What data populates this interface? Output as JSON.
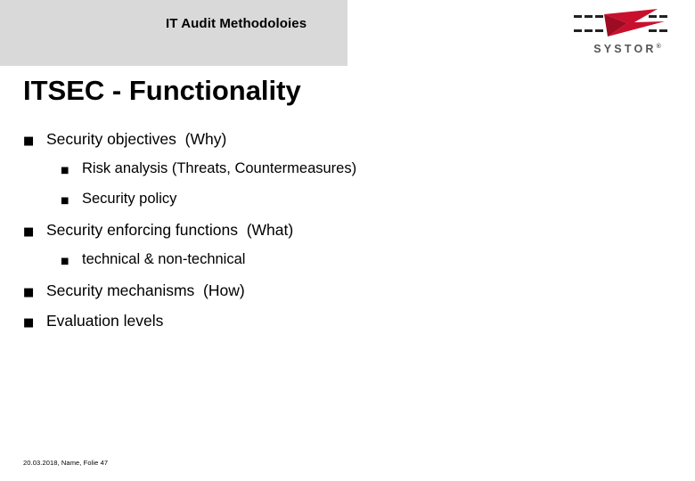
{
  "header": {
    "title": "IT Audit Methodoloies"
  },
  "logo": {
    "wordmark": "SYSTOR",
    "registered": "®",
    "colors": {
      "band": "#d9d9d9",
      "arrow_red": "#c8102e",
      "arrow_dark": "#222222",
      "wordmark": "#555555"
    }
  },
  "slide": {
    "title": "ITSEC - Functionality",
    "bullets": [
      {
        "level": 1,
        "marker": "■",
        "text": "Security objectives  (Why)"
      },
      {
        "level": 2,
        "marker": "■",
        "text": "Risk analysis (Threats, Countermeasures)"
      },
      {
        "level": 2,
        "marker": "■",
        "text": "Security policy"
      },
      {
        "level": 1,
        "marker": "■",
        "text": "Security enforcing functions  (What)"
      },
      {
        "level": 2,
        "marker": "■",
        "text": "technical & non-technical"
      },
      {
        "level": 1,
        "marker": "■",
        "text": "Security mechanisms  (How)"
      },
      {
        "level": 1,
        "marker": "■",
        "text": "Evaluation levels"
      }
    ]
  },
  "footer": {
    "text": "20.03.2018, Name, Folie 47"
  }
}
